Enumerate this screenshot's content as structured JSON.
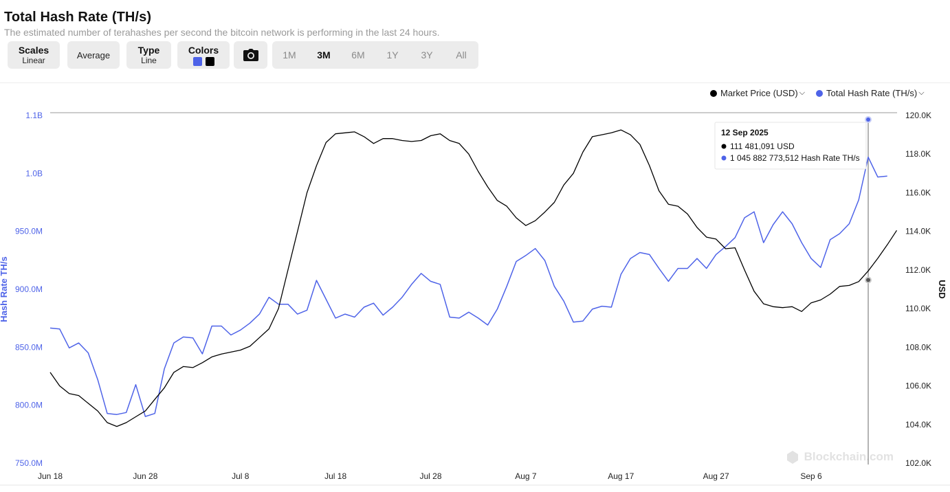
{
  "header": {
    "title": "Total Hash Rate (TH/s)",
    "subtitle": "The estimated number of terahashes per second the bitcoin network is performing in the last 24 hours."
  },
  "controls": {
    "scales": {
      "label": "Scales",
      "value": "Linear"
    },
    "average": {
      "label": "Average"
    },
    "type": {
      "label": "Type",
      "value": "Line"
    },
    "colors": {
      "label": "Colors",
      "swatches": [
        "#4e63e8",
        "#000000"
      ]
    },
    "camera_icon": "camera-icon",
    "ranges": [
      "1M",
      "3M",
      "6M",
      "1Y",
      "3Y",
      "All"
    ],
    "active_range": "3M"
  },
  "legend": {
    "market_price": {
      "label": "Market Price (USD)",
      "color": "#000000"
    },
    "hash_rate": {
      "label": "Total Hash Rate (TH/s)",
      "color": "#4e63e8"
    }
  },
  "tooltip": {
    "date": "12 Sep 2025",
    "price_line": "111 481,091 USD",
    "hash_line": "1 045 882 773,512 Hash Rate TH/s"
  },
  "watermark": "Blockchain.com",
  "chart_data": {
    "type": "line",
    "x_start": "2025-06-18",
    "x_end": "2025-09-15",
    "x_ticks": [
      "Jun 18",
      "Jun 28",
      "Jul 8",
      "Jul 18",
      "Jul 28",
      "Aug 7",
      "Aug 17",
      "Aug 27",
      "Sep 6"
    ],
    "left_axis": {
      "label": "Hash Rate TH/s",
      "ylim": [
        750000000,
        1100000000
      ],
      "ticks": [
        "750.0M",
        "800.0M",
        "850.0M",
        "900.0M",
        "950.0M",
        "1.0B",
        "1.1B"
      ]
    },
    "right_axis": {
      "label": "USD",
      "ylim": [
        102000,
        120000
      ],
      "ticks": [
        "102.0K",
        "104.0K",
        "106.0K",
        "108.0K",
        "110.0K",
        "112.0K",
        "114.0K",
        "116.0K",
        "118.0K",
        "120.0K"
      ]
    },
    "series": [
      {
        "name": "Total Hash Rate (TH/s)",
        "axis": "left",
        "color": "#4e63e8",
        "x": [
          "2025-06-18",
          "2025-06-19",
          "2025-06-20",
          "2025-06-21",
          "2025-06-22",
          "2025-06-23",
          "2025-06-24",
          "2025-06-25",
          "2025-06-26",
          "2025-06-27",
          "2025-06-28",
          "2025-06-29",
          "2025-06-30",
          "2025-07-01",
          "2025-07-02",
          "2025-07-03",
          "2025-07-04",
          "2025-07-05",
          "2025-07-06",
          "2025-07-07",
          "2025-07-08",
          "2025-07-09",
          "2025-07-10",
          "2025-07-11",
          "2025-07-12",
          "2025-07-13",
          "2025-07-14",
          "2025-07-15",
          "2025-07-16",
          "2025-07-17",
          "2025-07-18",
          "2025-07-19",
          "2025-07-20",
          "2025-07-21",
          "2025-07-22",
          "2025-07-23",
          "2025-07-24",
          "2025-07-25",
          "2025-07-26",
          "2025-07-27",
          "2025-07-28",
          "2025-07-29",
          "2025-07-30",
          "2025-07-31",
          "2025-08-01",
          "2025-08-02",
          "2025-08-03",
          "2025-08-04",
          "2025-08-05",
          "2025-08-06",
          "2025-08-07",
          "2025-08-08",
          "2025-08-09",
          "2025-08-10",
          "2025-08-11",
          "2025-08-12",
          "2025-08-13",
          "2025-08-14",
          "2025-08-15",
          "2025-08-16",
          "2025-08-17",
          "2025-08-18",
          "2025-08-19",
          "2025-08-20",
          "2025-08-21",
          "2025-08-22",
          "2025-08-23",
          "2025-08-24",
          "2025-08-25",
          "2025-08-26",
          "2025-08-27",
          "2025-08-28",
          "2025-08-29",
          "2025-08-30",
          "2025-08-31",
          "2025-09-01",
          "2025-09-02",
          "2025-09-03",
          "2025-09-04",
          "2025-09-05",
          "2025-09-06",
          "2025-09-07",
          "2025-09-08",
          "2025-09-09",
          "2025-09-10",
          "2025-09-11",
          "2025-09-12",
          "2025-09-13",
          "2025-09-14"
        ],
        "values": [
          886000000,
          885000000,
          866000000,
          871000000,
          861000000,
          834000000,
          800000000,
          799000000,
          801000000,
          829000000,
          797000000,
          800000000,
          845000000,
          871000000,
          877000000,
          876000000,
          860000000,
          888000000,
          888000000,
          879000000,
          884000000,
          891000000,
          900000000,
          917000000,
          910000000,
          910000000,
          900000000,
          904000000,
          934000000,
          915000000,
          896000000,
          900000000,
          897000000,
          907000000,
          911000000,
          899000000,
          907000000,
          917000000,
          930000000,
          941000000,
          933000000,
          930000000,
          897000000,
          896000000,
          902000000,
          896000000,
          889000000,
          905000000,
          928000000,
          953000000,
          959000000,
          966000000,
          954000000,
          928000000,
          913000000,
          892000000,
          893000000,
          905000000,
          908000000,
          907000000,
          940000000,
          956000000,
          962000000,
          960000000,
          946000000,
          933000000,
          946000000,
          946000000,
          956000000,
          946000000,
          960000000,
          968000000,
          977000000,
          997000000,
          1003000000,
          972000000,
          990000000,
          1003000000,
          991000000,
          972000000,
          956000000,
          947000000,
          975000000,
          981000000,
          991000000,
          1015000000,
          1058000000,
          1038000000,
          1039000000
        ]
      },
      {
        "name": "Market Price (USD)",
        "axis": "right",
        "color": "#000000",
        "x": [
          "2025-06-18",
          "2025-06-19",
          "2025-06-20",
          "2025-06-21",
          "2025-06-22",
          "2025-06-23",
          "2025-06-24",
          "2025-06-25",
          "2025-06-26",
          "2025-06-27",
          "2025-06-28",
          "2025-06-29",
          "2025-06-30",
          "2025-07-01",
          "2025-07-02",
          "2025-07-03",
          "2025-07-04",
          "2025-07-05",
          "2025-07-06",
          "2025-07-07",
          "2025-07-08",
          "2025-07-09",
          "2025-07-10",
          "2025-07-11",
          "2025-07-12",
          "2025-07-13",
          "2025-07-14",
          "2025-07-15",
          "2025-07-16",
          "2025-07-17",
          "2025-07-18",
          "2025-07-19",
          "2025-07-20",
          "2025-07-21",
          "2025-07-22",
          "2025-07-23",
          "2025-07-24",
          "2025-07-25",
          "2025-07-26",
          "2025-07-27",
          "2025-07-28",
          "2025-07-29",
          "2025-07-30",
          "2025-07-31",
          "2025-08-01",
          "2025-08-02",
          "2025-08-03",
          "2025-08-04",
          "2025-08-05",
          "2025-08-06",
          "2025-08-07",
          "2025-08-08",
          "2025-08-09",
          "2025-08-10",
          "2025-08-11",
          "2025-08-12",
          "2025-08-13",
          "2025-08-14",
          "2025-08-15",
          "2025-08-16",
          "2025-08-17",
          "2025-08-18",
          "2025-08-19",
          "2025-08-20",
          "2025-08-21",
          "2025-08-22",
          "2025-08-23",
          "2025-08-24",
          "2025-08-25",
          "2025-08-26",
          "2025-08-27",
          "2025-08-28",
          "2025-08-29",
          "2025-08-30",
          "2025-08-31",
          "2025-09-01",
          "2025-09-02",
          "2025-09-03",
          "2025-09-04",
          "2025-09-05",
          "2025-09-06",
          "2025-09-07",
          "2025-09-08",
          "2025-09-09",
          "2025-09-10",
          "2025-09-11",
          "2025-09-12",
          "2025-09-13",
          "2025-09-14",
          "2025-09-15"
        ],
        "values": [
          106700,
          106000,
          105600,
          105500,
          105100,
          104700,
          104100,
          103900,
          104100,
          104400,
          104700,
          105300,
          105900,
          106700,
          107000,
          106950,
          107200,
          107500,
          107650,
          107750,
          107850,
          108050,
          108500,
          108950,
          110000,
          112000,
          114000,
          116000,
          117400,
          118600,
          119050,
          119100,
          119150,
          118900,
          118550,
          118800,
          118800,
          118700,
          118650,
          118700,
          118950,
          119050,
          118700,
          118550,
          118000,
          117100,
          116300,
          115600,
          115300,
          114700,
          114300,
          114550,
          115000,
          115500,
          116400,
          117000,
          118100,
          118900,
          119000,
          119100,
          119250,
          119000,
          118500,
          117400,
          116100,
          115400,
          115300,
          114900,
          114200,
          113700,
          113600,
          113100,
          113150,
          112000,
          110900,
          110250,
          110100,
          110050,
          110100,
          109850,
          110300,
          110450,
          110750,
          111150,
          111200,
          111400,
          111950,
          112600,
          113300,
          114050
        ]
      }
    ],
    "tooltip_point": {
      "date": "2025-09-12",
      "price_usd": 111481.091,
      "hash_rate": 1045882773.512
    },
    "grid": false,
    "legend_position": "top-right"
  }
}
